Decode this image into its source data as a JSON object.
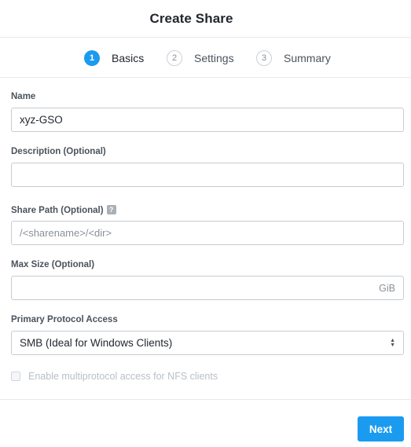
{
  "dialog": {
    "title": "Create Share"
  },
  "steps": [
    {
      "number": "1",
      "label": "Basics",
      "state": "active"
    },
    {
      "number": "2",
      "label": "Settings",
      "state": "inactive"
    },
    {
      "number": "3",
      "label": "Summary",
      "state": "inactive"
    }
  ],
  "form": {
    "name": {
      "label": "Name",
      "value": "xyz-GSO"
    },
    "description": {
      "label": "Description (Optional)",
      "value": ""
    },
    "share_path": {
      "label": "Share Path (Optional)",
      "placeholder": "/<sharename>/<dir>",
      "help_icon": "?"
    },
    "max_size": {
      "label": "Max Size (Optional)",
      "value": "",
      "unit": "GiB"
    },
    "protocol": {
      "label": "Primary Protocol Access",
      "selected": "SMB (Ideal for Windows Clients)"
    },
    "multiprotocol": {
      "label": "Enable multiprotocol access for NFS clients",
      "checked": false,
      "disabled": true
    }
  },
  "footer": {
    "next_label": "Next"
  },
  "colors": {
    "accent": "#1b9bf0",
    "border": "#c6ccd3",
    "divider": "#e6e9ed"
  }
}
